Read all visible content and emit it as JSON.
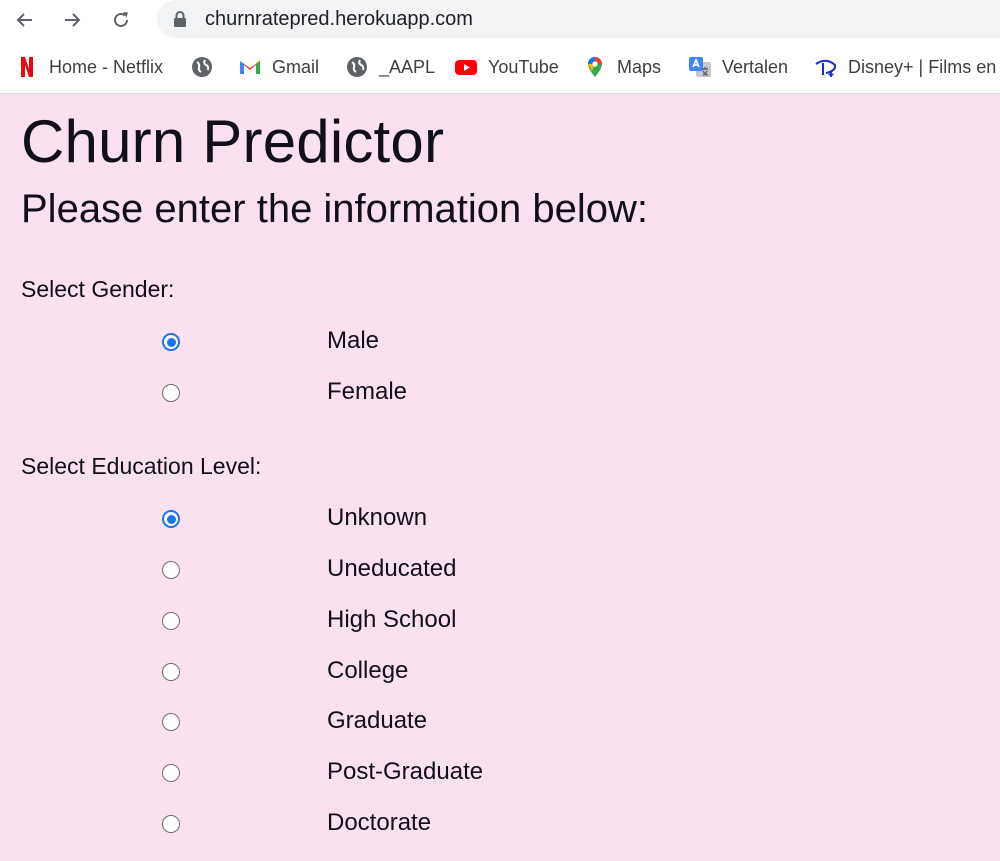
{
  "browser": {
    "url": "churnratepred.herokuapp.com",
    "bookmarks": [
      {
        "label": "Home - Netflix",
        "icon": "netflix-icon"
      },
      {
        "label": "",
        "icon": "globe-icon"
      },
      {
        "label": "Gmail",
        "icon": "gmail-icon"
      },
      {
        "label": "_AAPL",
        "icon": "globe-icon"
      },
      {
        "label": "YouTube",
        "icon": "youtube-icon"
      },
      {
        "label": "Maps",
        "icon": "maps-icon"
      },
      {
        "label": "Vertalen",
        "icon": "translate-icon"
      },
      {
        "label": "Disney+ | Films en",
        "icon": "disney-plus-icon"
      }
    ]
  },
  "page": {
    "title": "Churn Predictor",
    "subtitle": "Please enter the information below:",
    "gender": {
      "label": "Select Gender:",
      "options": [
        {
          "label": "Male",
          "checked": true
        },
        {
          "label": "Female",
          "checked": false
        }
      ]
    },
    "education": {
      "label": "Select Education Level:",
      "options": [
        {
          "label": "Unknown",
          "checked": true
        },
        {
          "label": "Uneducated",
          "checked": false
        },
        {
          "label": "High School",
          "checked": false
        },
        {
          "label": "College",
          "checked": false
        },
        {
          "label": "Graduate",
          "checked": false
        },
        {
          "label": "Post-Graduate",
          "checked": false
        },
        {
          "label": "Doctorate",
          "checked": false
        }
      ]
    }
  },
  "colors": {
    "page_background": "#f9e1ef",
    "radio_accent": "#1a73e8"
  }
}
